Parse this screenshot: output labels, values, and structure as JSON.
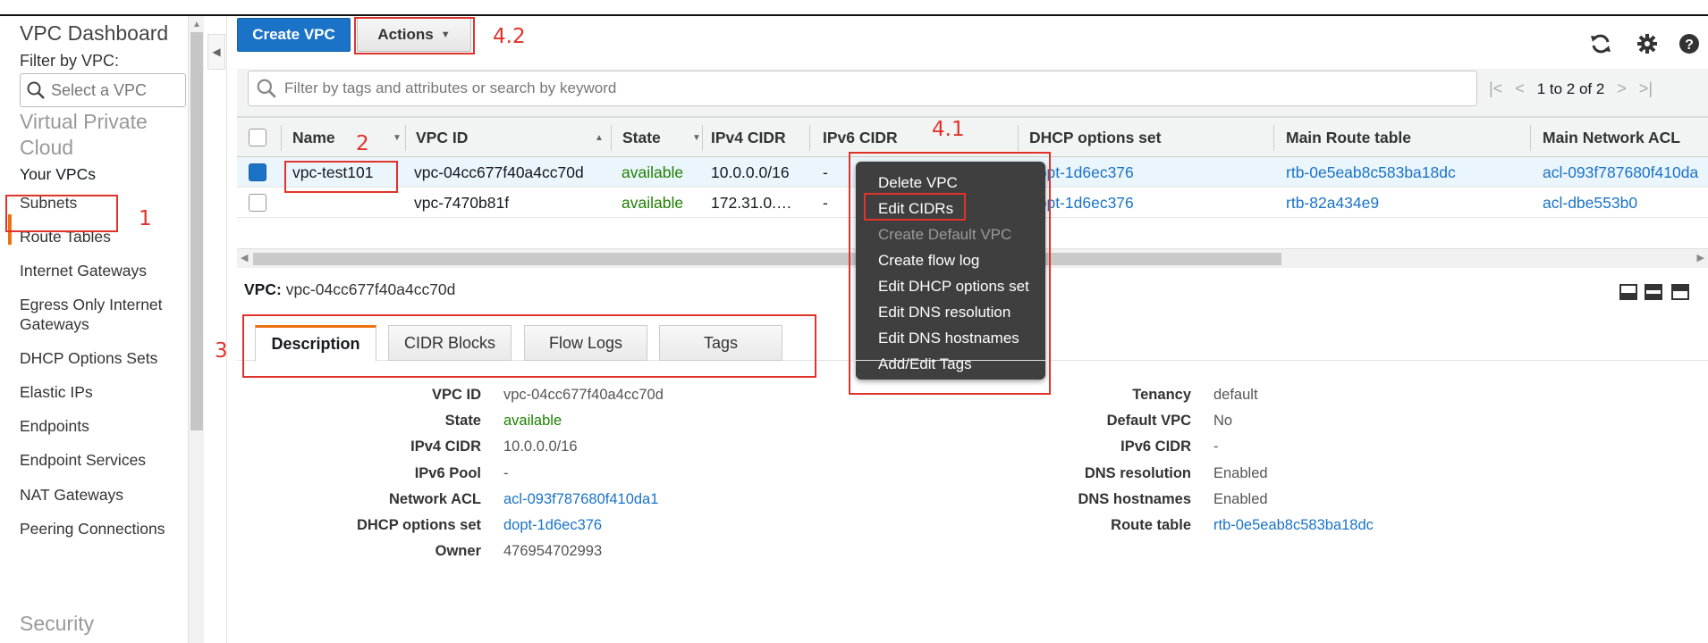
{
  "sidebar": {
    "title": "VPC Dashboard",
    "filter_label": "Filter by VPC:",
    "filter_placeholder": "Select a VPC",
    "section_vpc": "Virtual Private Cloud",
    "items": [
      "Your VPCs",
      "Subnets",
      "Route Tables",
      "Internet Gateways",
      "Egress Only Internet Gateways",
      "DHCP Options Sets",
      "Elastic IPs",
      "Endpoints",
      "Endpoint Services",
      "NAT Gateways",
      "Peering Connections"
    ],
    "section_security": "Security"
  },
  "toolbar": {
    "create_label": "Create VPC",
    "actions_label": "Actions"
  },
  "search": {
    "placeholder": "Filter by tags and attributes or search by keyword",
    "pagination": "1 to 2 of 2"
  },
  "table": {
    "columns": [
      "Name",
      "VPC ID",
      "State",
      "IPv4 CIDR",
      "IPv6 CIDR",
      "DHCP options set",
      "Main Route table",
      "Main Network ACL"
    ],
    "rows": [
      {
        "name": "vpc-test101",
        "vpc_id": "vpc-04cc677f40a4cc70d",
        "state": "available",
        "ipv4": "10.0.0.0/16",
        "ipv6": "-",
        "dhcp": "dopt-1d6ec376",
        "route": "rtb-0e5eab8c583ba18dc",
        "acl": "acl-093f787680f410da"
      },
      {
        "name": "",
        "vpc_id": "vpc-7470b81f",
        "state": "available",
        "ipv4": "172.31.0.…",
        "ipv6": "-",
        "dhcp": "dopt-1d6ec376",
        "route": "rtb-82a434e9",
        "acl": "acl-dbe553b0"
      }
    ]
  },
  "context_menu": {
    "items": [
      "Delete VPC",
      "Edit CIDRs",
      "Create Default VPC",
      "Create flow log",
      "Edit DHCP options set",
      "Edit DNS resolution",
      "Edit DNS hostnames",
      "Add/Edit Tags"
    ]
  },
  "detail": {
    "vpc_prefix": "VPC:",
    "vpc_value": "vpc-04cc677f40a4cc70d",
    "tabs": [
      "Description",
      "CIDR Blocks",
      "Flow Logs",
      "Tags"
    ],
    "left": [
      {
        "label": "VPC ID",
        "value": "vpc-04cc677f40a4cc70d"
      },
      {
        "label": "State",
        "value": "available"
      },
      {
        "label": "IPv4 CIDR",
        "value": "10.0.0.0/16"
      },
      {
        "label": "IPv6 Pool",
        "value": "-"
      },
      {
        "label": "Network ACL",
        "value": "acl-093f787680f410da1"
      },
      {
        "label": "DHCP options set",
        "value": "dopt-1d6ec376"
      },
      {
        "label": "Owner",
        "value": "476954702993"
      }
    ],
    "right": [
      {
        "label": "Tenancy",
        "value": "default"
      },
      {
        "label": "Default VPC",
        "value": "No"
      },
      {
        "label": "IPv6 CIDR",
        "value": "-"
      },
      {
        "label": "DNS resolution",
        "value": "Enabled"
      },
      {
        "label": "DNS hostnames",
        "value": "Enabled"
      },
      {
        "label": "Route table",
        "value": "rtb-0e5eab8c583ba18dc"
      }
    ]
  },
  "annotations": {
    "a1": "1",
    "a2": "2",
    "a3": "3",
    "a41": "4.1",
    "a42": "4.2"
  },
  "colors": {
    "accent": "#ec7211",
    "primary": "#1a73c7",
    "success": "#1d8102",
    "annotation": "#e0332b"
  },
  "icons": [
    "search-icon",
    "refresh-icon",
    "gear-icon",
    "help-icon",
    "caret-down-icon"
  ]
}
